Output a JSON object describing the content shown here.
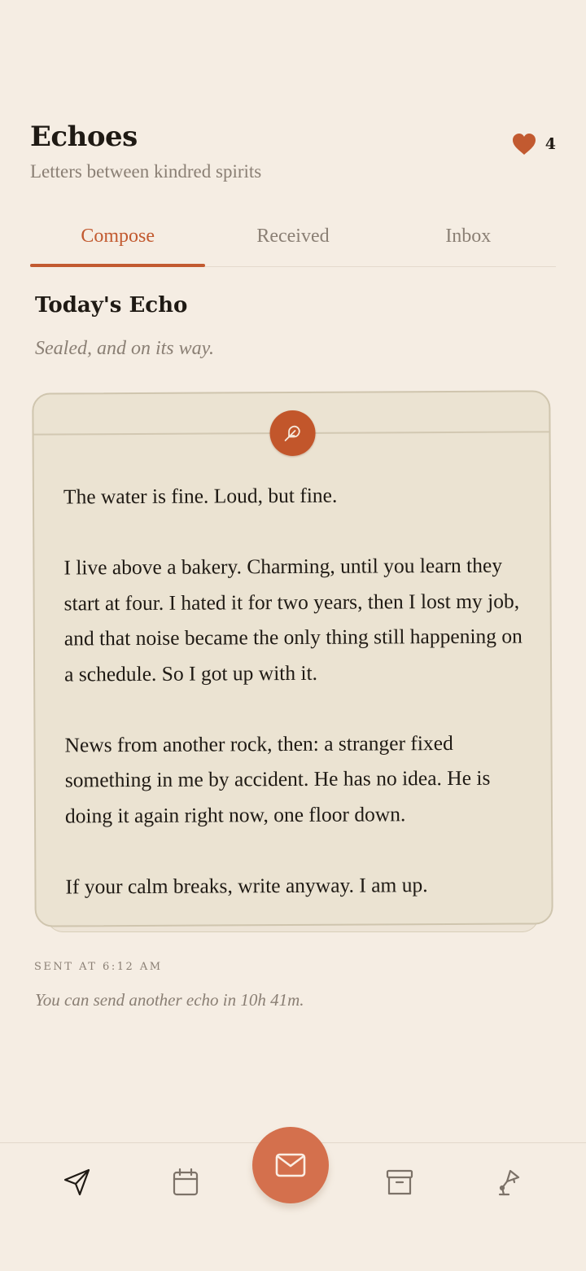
{
  "header": {
    "title": "Echoes",
    "subtitle": "Letters between kindred spirits",
    "likes_count": "4",
    "likes_icon": "heart-icon"
  },
  "tabs": [
    {
      "label": "Compose",
      "active": true
    },
    {
      "label": "Received",
      "active": false
    },
    {
      "label": "Inbox",
      "active": false
    }
  ],
  "today": {
    "title": "Today's Echo",
    "status": "Sealed, and on its way."
  },
  "letter": {
    "seal_icon": "feather-icon",
    "paragraphs": [
      "The water is fine. Loud, but fine.",
      "I live above a bakery. Charming, until you learn they start at four. I hated it for two years, then I lost my job, and that noise became the only thing still happening on a schedule. So I got up with it.",
      "News from another rock, then: a stranger fixed something in me by accident. He has no idea. He is doing it again right now, one floor down.",
      "If your calm breaks, write anyway. I am up."
    ]
  },
  "footer": {
    "sent_at": "SENT AT 6:12 AM",
    "next_echo": "You can send another echo in 10h 41m."
  },
  "nav": {
    "items": [
      "send-icon",
      "calendar-icon",
      "mail-icon",
      "archive-icon",
      "lamp-icon"
    ]
  },
  "colors": {
    "accent": "#c25a30",
    "fab": "#d4704d",
    "background": "#f5ede3",
    "paper": "#ebe3d2",
    "muted_text": "#8a7f74"
  }
}
